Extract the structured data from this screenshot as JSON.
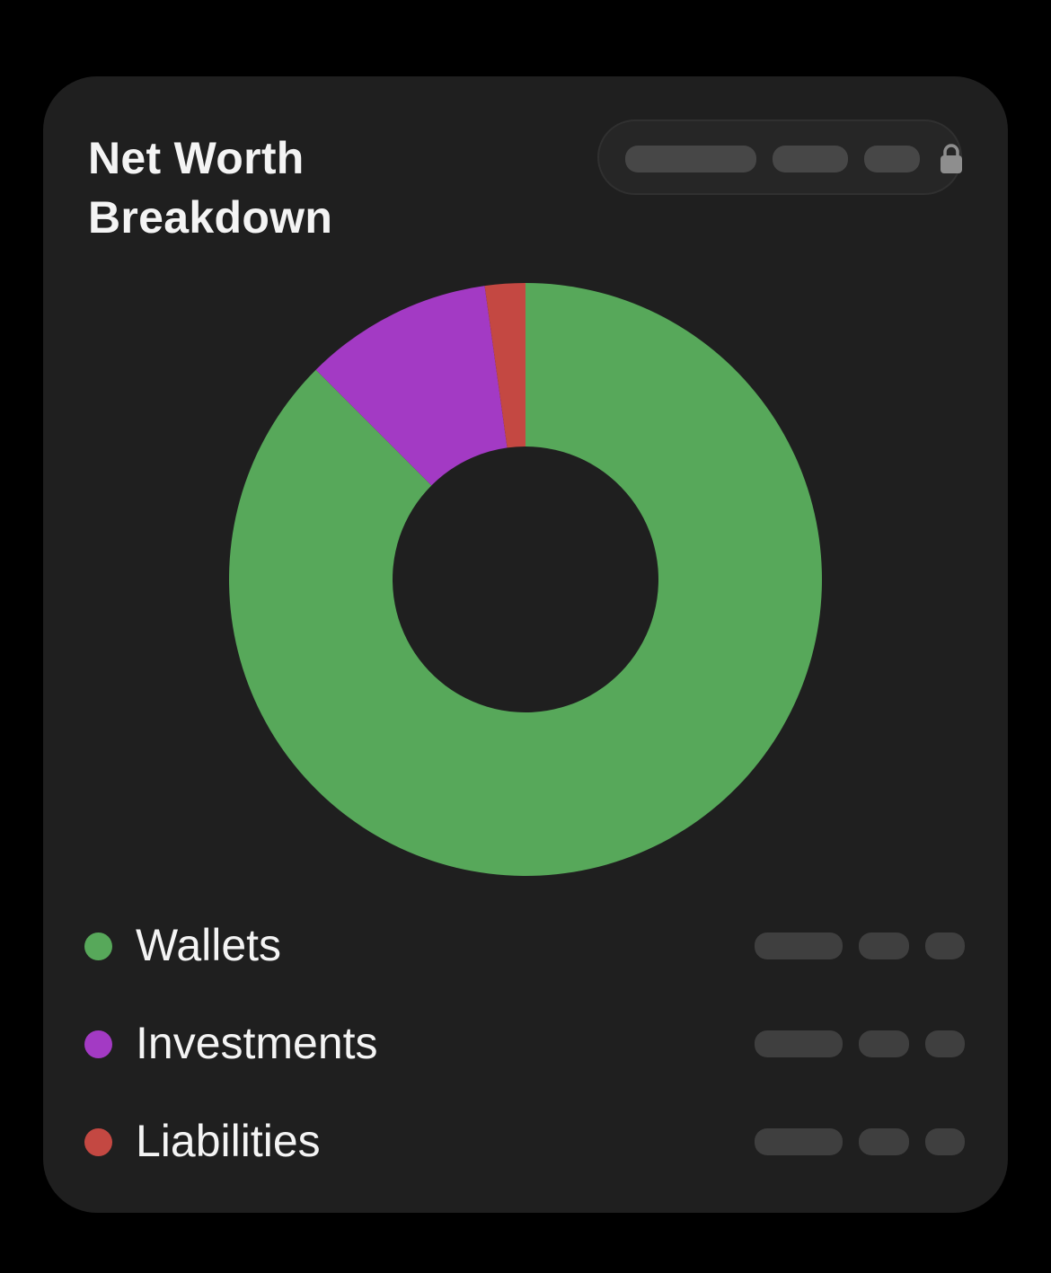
{
  "card": {
    "title": "Net Worth Breakdown"
  },
  "privacy_toggle": {
    "icon": "lock-icon",
    "state": "hidden"
  },
  "chart_data": {
    "type": "pie",
    "style": "donut",
    "title": "",
    "categories": [
      "Wallets",
      "Investments",
      "Liabilities"
    ],
    "values": [
      87.5,
      10.3,
      2.2
    ],
    "colors": [
      "#57a85a",
      "#a33ac4",
      "#c44842"
    ],
    "legend": "below"
  },
  "legend": [
    {
      "label": "Wallets",
      "color": "#57a85a"
    },
    {
      "label": "Investments",
      "color": "#a33ac4"
    },
    {
      "label": "Liabilities",
      "color": "#c44842"
    }
  ]
}
